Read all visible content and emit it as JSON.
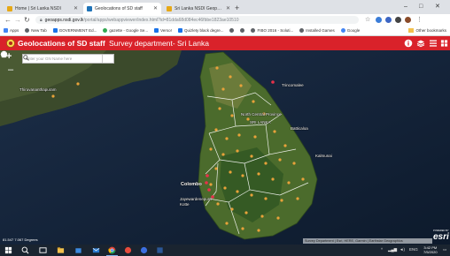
{
  "browser": {
    "tabs": [
      {
        "title": "Home | Sri Lanka NSDI",
        "favicon_color": "#e6a817",
        "active": false
      },
      {
        "title": "Geolocations of SD staff",
        "favicon_color": "#1f73b7",
        "active": true
      },
      {
        "title": "Sri Lanka NSDI Geoportal",
        "favicon_color": "#e6a817",
        "active": false
      }
    ],
    "new_tab_glyph": "+",
    "url_domain": "geoapps.nsdi.gov.lk",
    "url_path": "/portal/apps/webappviewer/index.html?id=81dda68d084ec46fbbe1823ae10510",
    "window_controls": {
      "minimize": "–",
      "maximize": "□",
      "close": "✕"
    }
  },
  "bookmarks": [
    {
      "label": "Apps",
      "color": "#4285f4"
    },
    {
      "label": "New Tab",
      "color": "#5f6368"
    },
    {
      "label": "GOVERNMENT Ed...",
      "color": "#1a73e8"
    },
    {
      "label": "gazette - Google Se...",
      "color": "#34a853"
    },
    {
      "label": "Verso!",
      "color": "#1a73e8"
    },
    {
      "label": "Quizlety black degre...",
      "color": "#1a73e8"
    },
    {
      "label": "",
      "color": "#5f6368"
    },
    {
      "label": "",
      "color": "#5f6368"
    },
    {
      "label": "FIBO 2016 - Soluti...",
      "color": "#5f6368"
    },
    {
      "label": "Installed Games",
      "color": "#5f6368"
    },
    {
      "label": "Google",
      "color": "#4285f4"
    }
  ],
  "bookmarks_other": "Other bookmarks",
  "app": {
    "title": "Geolocations of SD staff",
    "subtitle": "Survey department- Sri Lanka",
    "header_color": "#d9222a"
  },
  "map": {
    "search_placeholder": "Enter your GN Name here",
    "zoom_in": "+",
    "zoom_out": "–",
    "places": [
      {
        "label": "Thiruvananthapuram",
        "key": "trivandrum"
      },
      {
        "label": "Trincomalee",
        "key": "trincomalee"
      },
      {
        "label": "North Central Province",
        "key": "ncp"
      },
      {
        "label": "SRI LANKA",
        "key": "srilanka"
      },
      {
        "label": "Batticaloa",
        "key": "batticaloa"
      },
      {
        "label": "Kalmunai",
        "key": "kalmunai"
      },
      {
        "label": "Colombo",
        "key": "colombo"
      },
      {
        "label": "Jayewardenepura Kotte",
        "key": "kotte"
      }
    ],
    "coordinates": "81.547 7.067 Degrees",
    "attribution": "Survey Department | Esri, HERE, Garmin | Earthstar Geographics",
    "esri_powered": "POWERED BY",
    "esri_logo": "esri"
  },
  "taskbar": {
    "lang": "ENG",
    "time": "3:42 PM",
    "date": "7/5/2020"
  }
}
